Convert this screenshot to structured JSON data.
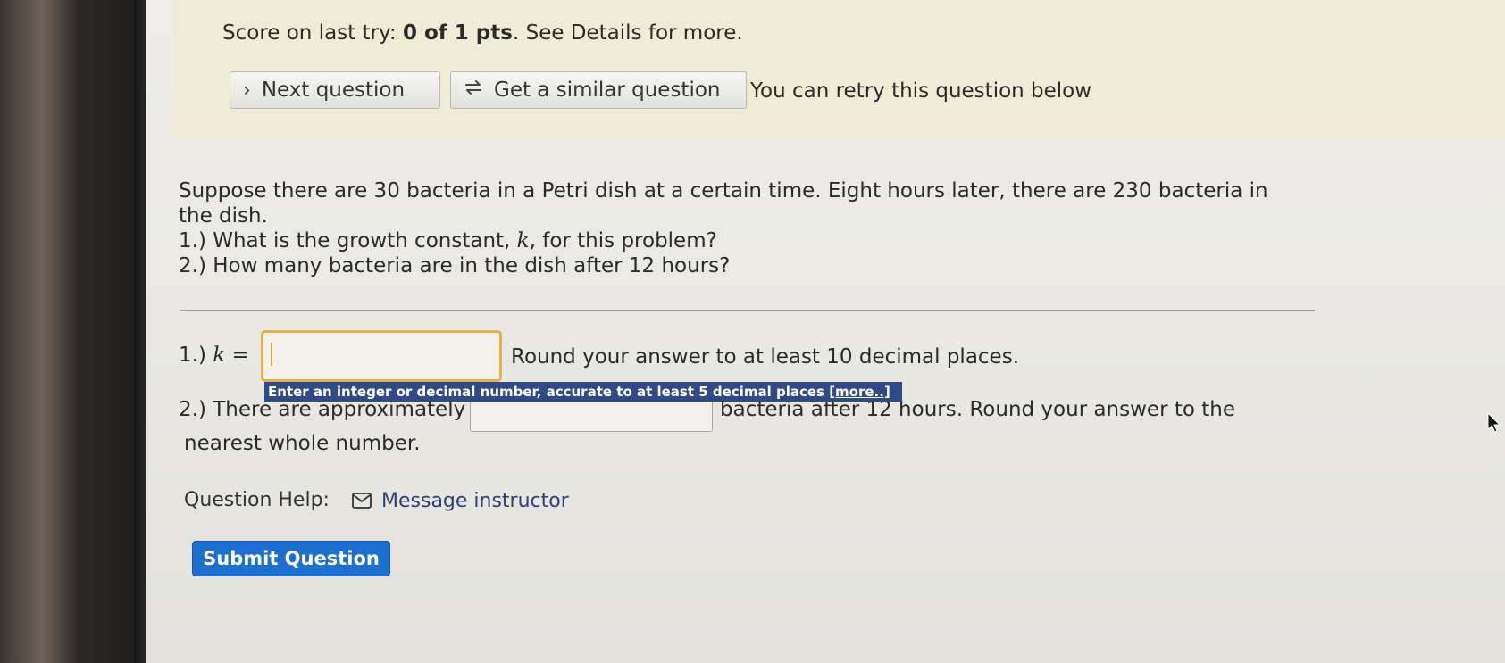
{
  "banner": {
    "score_prefix": "Score on last try: ",
    "score_value": "0 of 1 pts",
    "score_suffix": ". See Details for more.",
    "next_label": "Next question",
    "similar_label": "Get a similar question",
    "retry_text": "You can retry this question below"
  },
  "problem": {
    "intro": "Suppose there are 30 bacteria in a Petri dish at a certain time. Eight hours later, there are 230 bacteria in the dish.",
    "q1_a": "1.) What is the growth constant, ",
    "q1_var": "k",
    "q1_b": ", for this problem?",
    "q2": "2.) How many bacteria are in the dish after 12 hours?"
  },
  "answers": {
    "q1_prefix": "1.) ",
    "q1_var": "k",
    "q1_eq": " = ",
    "k_value": "",
    "q1_round": "Round your answer to at least 10 decimal places.",
    "tooltip_text": "Enter an integer or decimal number, accurate to at least 5 decimal places ",
    "tooltip_more": "[more..]",
    "q2_prefix": "2.) There are approximately",
    "bacteria_value": "",
    "q2_suffix": "bacteria after 12 hours. Round your answer to the",
    "q2_tail": "nearest whole number."
  },
  "help": {
    "label": "Question Help:",
    "message_label": "Message instructor"
  },
  "submit_label": "Submit Question",
  "colors": {
    "accent": "#1b6fd0",
    "banner": "#efebd5",
    "tooltip": "#2f4a87",
    "focus": "#e3b24e"
  }
}
